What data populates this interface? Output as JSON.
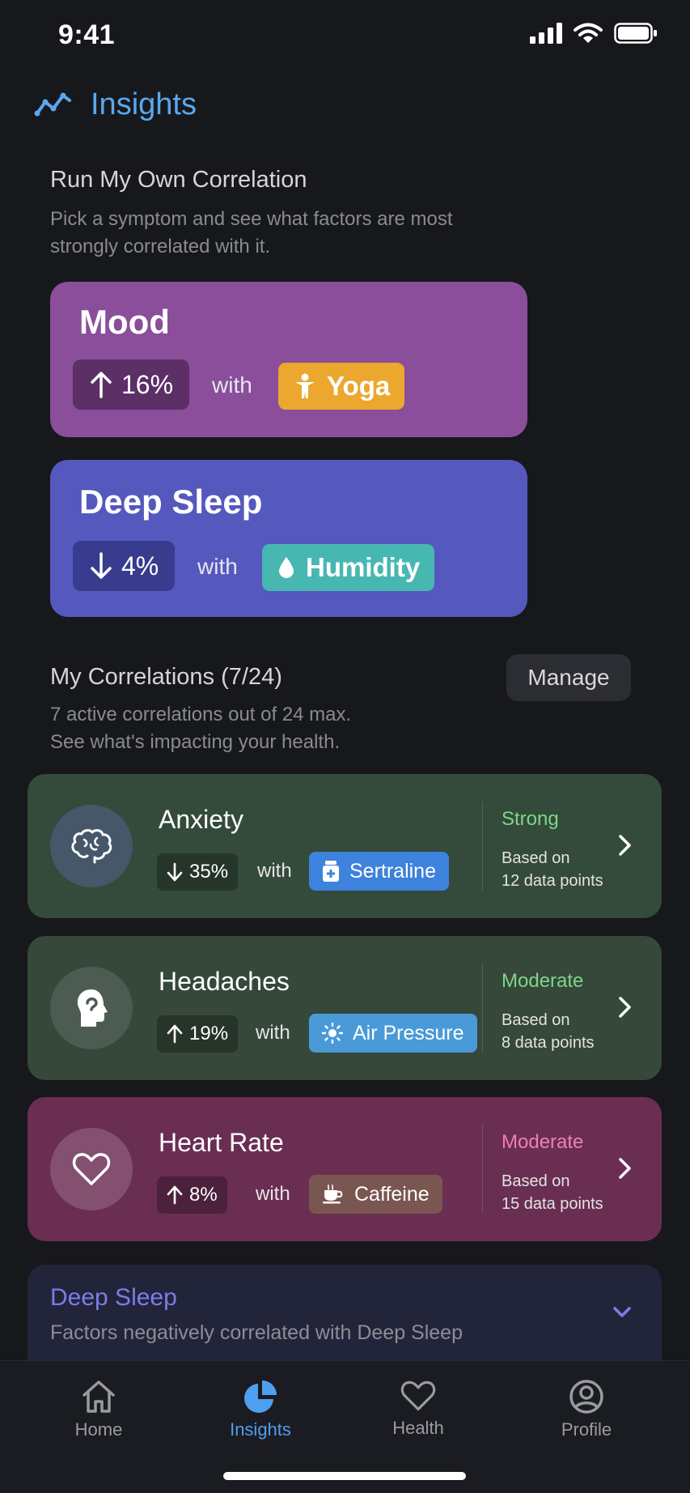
{
  "status_bar": {
    "time": "9:41"
  },
  "header": {
    "title": "Insights"
  },
  "run_section": {
    "title": "Run My Own Correlation",
    "subtitle_line1": "Pick a symptom and see what factors are most",
    "subtitle_line2": "strongly correlated with it."
  },
  "featured": [
    {
      "symptom": "Mood",
      "direction": "up",
      "percent": "16%",
      "with": "with",
      "factor": "Yoga",
      "factor_icon": "person-icon",
      "card_color": "#8a4e9a",
      "factor_color": "#eba72e"
    },
    {
      "symptom": "Deep Sleep",
      "direction": "down",
      "percent": "4%",
      "with": "with",
      "factor": "Humidity",
      "factor_icon": "droplet-icon",
      "card_color": "#5558bd",
      "factor_color": "#47b7b2"
    }
  ],
  "my_correlations": {
    "title": "My Correlations (7/24)",
    "manage_label": "Manage",
    "subtitle_line1": "7 active correlations out of 24 max.",
    "subtitle_line2": "See what's impacting your health."
  },
  "correlations": [
    {
      "symptom": "Anxiety",
      "symptom_icon": "brain-icon",
      "direction": "down",
      "percent": "35%",
      "with": "with",
      "factor": "Sertraline",
      "factor_icon": "pill-bottle-icon",
      "factor_color": "#3d82dc",
      "strength": "Strong",
      "strength_color": "#7fd68a",
      "based_line1": "Based on",
      "based_line2": "12 data points",
      "card_color": "#344a3a"
    },
    {
      "symptom": "Headaches",
      "symptom_icon": "head-icon",
      "direction": "up",
      "percent": "19%",
      "with": "with",
      "factor": "Air Pressure",
      "factor_icon": "sun-icon",
      "factor_color": "#4a9ad8",
      "strength": "Moderate",
      "strength_color": "#7fd68a",
      "based_line1": "Based on",
      "based_line2": "8 data points",
      "card_color": "#354839"
    },
    {
      "symptom": "Heart Rate",
      "symptom_icon": "heart-icon",
      "direction": "up",
      "percent": "8%",
      "with": "with",
      "factor": "Caffeine",
      "factor_icon": "coffee-icon",
      "factor_color": "#7a5650",
      "strength": "Moderate",
      "strength_color": "#ef7fb4",
      "based_line1": "Based on",
      "based_line2": "15 data points",
      "card_color": "#6a2e52"
    }
  ],
  "deep_sleep_section": {
    "title": "Deep Sleep",
    "subtitle": "Factors negatively correlated with Deep Sleep"
  },
  "tabs": [
    {
      "label": "Home",
      "icon": "home-icon",
      "active": false
    },
    {
      "label": "Insights",
      "icon": "pie-chart-icon",
      "active": true
    },
    {
      "label": "Health",
      "icon": "heart-icon",
      "active": false
    },
    {
      "label": "Profile",
      "icon": "user-icon",
      "active": false
    }
  ]
}
